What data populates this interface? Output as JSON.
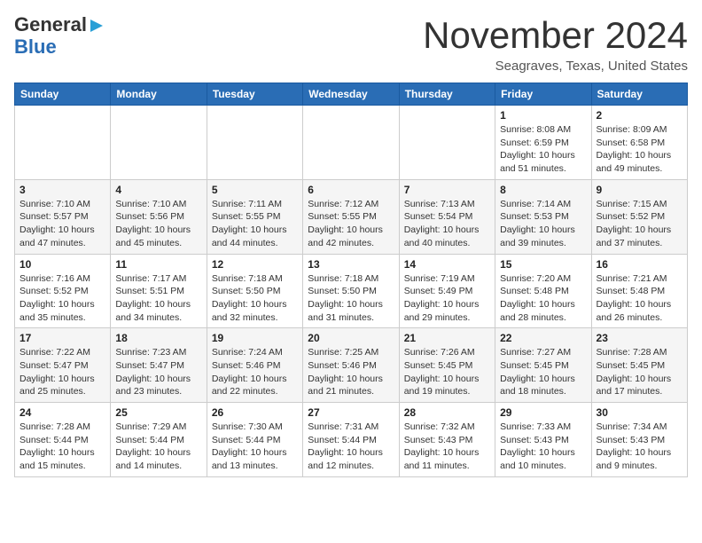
{
  "header": {
    "logo_line1": "General",
    "logo_line2": "Blue",
    "month": "November 2024",
    "location": "Seagraves, Texas, United States"
  },
  "days_of_week": [
    "Sunday",
    "Monday",
    "Tuesday",
    "Wednesday",
    "Thursday",
    "Friday",
    "Saturday"
  ],
  "weeks": [
    [
      {
        "num": "",
        "detail": ""
      },
      {
        "num": "",
        "detail": ""
      },
      {
        "num": "",
        "detail": ""
      },
      {
        "num": "",
        "detail": ""
      },
      {
        "num": "",
        "detail": ""
      },
      {
        "num": "1",
        "detail": "Sunrise: 8:08 AM\nSunset: 6:59 PM\nDaylight: 10 hours\nand 51 minutes."
      },
      {
        "num": "2",
        "detail": "Sunrise: 8:09 AM\nSunset: 6:58 PM\nDaylight: 10 hours\nand 49 minutes."
      }
    ],
    [
      {
        "num": "3",
        "detail": "Sunrise: 7:10 AM\nSunset: 5:57 PM\nDaylight: 10 hours\nand 47 minutes."
      },
      {
        "num": "4",
        "detail": "Sunrise: 7:10 AM\nSunset: 5:56 PM\nDaylight: 10 hours\nand 45 minutes."
      },
      {
        "num": "5",
        "detail": "Sunrise: 7:11 AM\nSunset: 5:55 PM\nDaylight: 10 hours\nand 44 minutes."
      },
      {
        "num": "6",
        "detail": "Sunrise: 7:12 AM\nSunset: 5:55 PM\nDaylight: 10 hours\nand 42 minutes."
      },
      {
        "num": "7",
        "detail": "Sunrise: 7:13 AM\nSunset: 5:54 PM\nDaylight: 10 hours\nand 40 minutes."
      },
      {
        "num": "8",
        "detail": "Sunrise: 7:14 AM\nSunset: 5:53 PM\nDaylight: 10 hours\nand 39 minutes."
      },
      {
        "num": "9",
        "detail": "Sunrise: 7:15 AM\nSunset: 5:52 PM\nDaylight: 10 hours\nand 37 minutes."
      }
    ],
    [
      {
        "num": "10",
        "detail": "Sunrise: 7:16 AM\nSunset: 5:52 PM\nDaylight: 10 hours\nand 35 minutes."
      },
      {
        "num": "11",
        "detail": "Sunrise: 7:17 AM\nSunset: 5:51 PM\nDaylight: 10 hours\nand 34 minutes."
      },
      {
        "num": "12",
        "detail": "Sunrise: 7:18 AM\nSunset: 5:50 PM\nDaylight: 10 hours\nand 32 minutes."
      },
      {
        "num": "13",
        "detail": "Sunrise: 7:18 AM\nSunset: 5:50 PM\nDaylight: 10 hours\nand 31 minutes."
      },
      {
        "num": "14",
        "detail": "Sunrise: 7:19 AM\nSunset: 5:49 PM\nDaylight: 10 hours\nand 29 minutes."
      },
      {
        "num": "15",
        "detail": "Sunrise: 7:20 AM\nSunset: 5:48 PM\nDaylight: 10 hours\nand 28 minutes."
      },
      {
        "num": "16",
        "detail": "Sunrise: 7:21 AM\nSunset: 5:48 PM\nDaylight: 10 hours\nand 26 minutes."
      }
    ],
    [
      {
        "num": "17",
        "detail": "Sunrise: 7:22 AM\nSunset: 5:47 PM\nDaylight: 10 hours\nand 25 minutes."
      },
      {
        "num": "18",
        "detail": "Sunrise: 7:23 AM\nSunset: 5:47 PM\nDaylight: 10 hours\nand 23 minutes."
      },
      {
        "num": "19",
        "detail": "Sunrise: 7:24 AM\nSunset: 5:46 PM\nDaylight: 10 hours\nand 22 minutes."
      },
      {
        "num": "20",
        "detail": "Sunrise: 7:25 AM\nSunset: 5:46 PM\nDaylight: 10 hours\nand 21 minutes."
      },
      {
        "num": "21",
        "detail": "Sunrise: 7:26 AM\nSunset: 5:45 PM\nDaylight: 10 hours\nand 19 minutes."
      },
      {
        "num": "22",
        "detail": "Sunrise: 7:27 AM\nSunset: 5:45 PM\nDaylight: 10 hours\nand 18 minutes."
      },
      {
        "num": "23",
        "detail": "Sunrise: 7:28 AM\nSunset: 5:45 PM\nDaylight: 10 hours\nand 17 minutes."
      }
    ],
    [
      {
        "num": "24",
        "detail": "Sunrise: 7:28 AM\nSunset: 5:44 PM\nDaylight: 10 hours\nand 15 minutes."
      },
      {
        "num": "25",
        "detail": "Sunrise: 7:29 AM\nSunset: 5:44 PM\nDaylight: 10 hours\nand 14 minutes."
      },
      {
        "num": "26",
        "detail": "Sunrise: 7:30 AM\nSunset: 5:44 PM\nDaylight: 10 hours\nand 13 minutes."
      },
      {
        "num": "27",
        "detail": "Sunrise: 7:31 AM\nSunset: 5:44 PM\nDaylight: 10 hours\nand 12 minutes."
      },
      {
        "num": "28",
        "detail": "Sunrise: 7:32 AM\nSunset: 5:43 PM\nDaylight: 10 hours\nand 11 minutes."
      },
      {
        "num": "29",
        "detail": "Sunrise: 7:33 AM\nSunset: 5:43 PM\nDaylight: 10 hours\nand 10 minutes."
      },
      {
        "num": "30",
        "detail": "Sunrise: 7:34 AM\nSunset: 5:43 PM\nDaylight: 10 hours\nand 9 minutes."
      }
    ]
  ]
}
